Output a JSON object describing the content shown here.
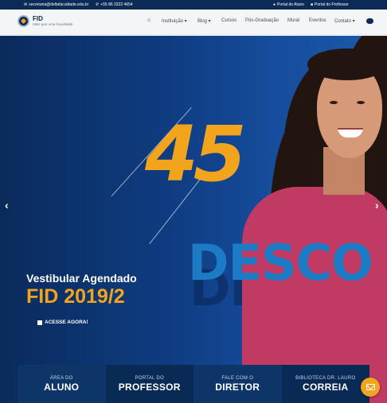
{
  "topbar": {
    "email": "secretaria@deltafaculdade.edu.br",
    "phone": "+55 86 3322 4654",
    "portal_aluno": "Portal do Aluno",
    "portal_professor": "Portal do Professor",
    "icons": [
      "envelope-icon",
      "phone-icon",
      "user-icon",
      "book-icon"
    ]
  },
  "brand": {
    "name": "FID",
    "slogan": "Mais que uma Faculdade"
  },
  "nav": {
    "items": [
      "Instituição ▾",
      "Blog ▾",
      "Cursos",
      "Pós-Graduação",
      "Mural",
      "Eventos",
      "Contato ▾"
    ]
  },
  "hero": {
    "big_number": "45",
    "desc_word": "DESCO",
    "headline_1": "Vestibular Agendado",
    "headline_2": "FID 2019/2",
    "cta": "ACESSE AGORA!",
    "prev_arrow": "‹",
    "next_arrow": "›"
  },
  "tiles": [
    {
      "small": "ÁREA DO",
      "big": "ALUNO"
    },
    {
      "small": "PORTAL DO",
      "big": "PROFESSOR"
    },
    {
      "small": "FALE COM O",
      "big": "DIRETOR"
    },
    {
      "small": "BIBLIOTECA DR. LAURO",
      "big": "CORREIA"
    }
  ],
  "colors": {
    "primary_dark": "#0b2a55",
    "accent_orange": "#f2a51c",
    "accent_blue": "#1d7ac4"
  }
}
